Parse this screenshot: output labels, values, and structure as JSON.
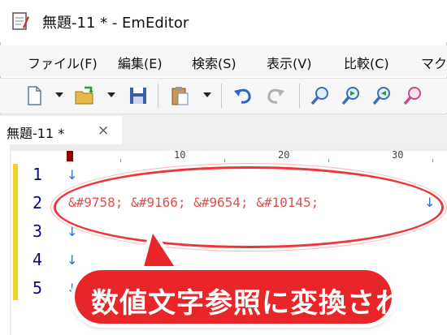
{
  "window": {
    "title": "無題-11 * - EmEditor",
    "app_icon": "notepad-icon"
  },
  "menu": {
    "items": [
      "ファイル(F)",
      "編集(E)",
      "検索(S)",
      "表示(V)",
      "比較(C)",
      "マク"
    ]
  },
  "toolbar": {
    "icons": [
      "new-file-icon",
      "open-folder-icon",
      "save-icon",
      "paste-icon",
      "undo-icon",
      "redo-icon",
      "find-icon",
      "find-next-icon",
      "find-prev-icon",
      "highlight-icon"
    ]
  },
  "tabs": [
    {
      "label": "無題-11 *",
      "close": "×"
    }
  ],
  "ruler": {
    "labels": [
      "10",
      "20",
      "30"
    ]
  },
  "editor": {
    "line_numbers": [
      "1",
      "2",
      "3",
      "4",
      "5"
    ],
    "lines": [
      "",
      "&#9758; &#9166; &#9654; &#10145;",
      "",
      "",
      ""
    ],
    "eol_mark": "↓"
  },
  "callout": {
    "text": "数値文字参照に変換される"
  },
  "colors": {
    "accent_red": "#e8262a",
    "modified_bar": "#f1d42a",
    "code_text": "#e05050",
    "eol_mark": "#2a6fd8"
  }
}
